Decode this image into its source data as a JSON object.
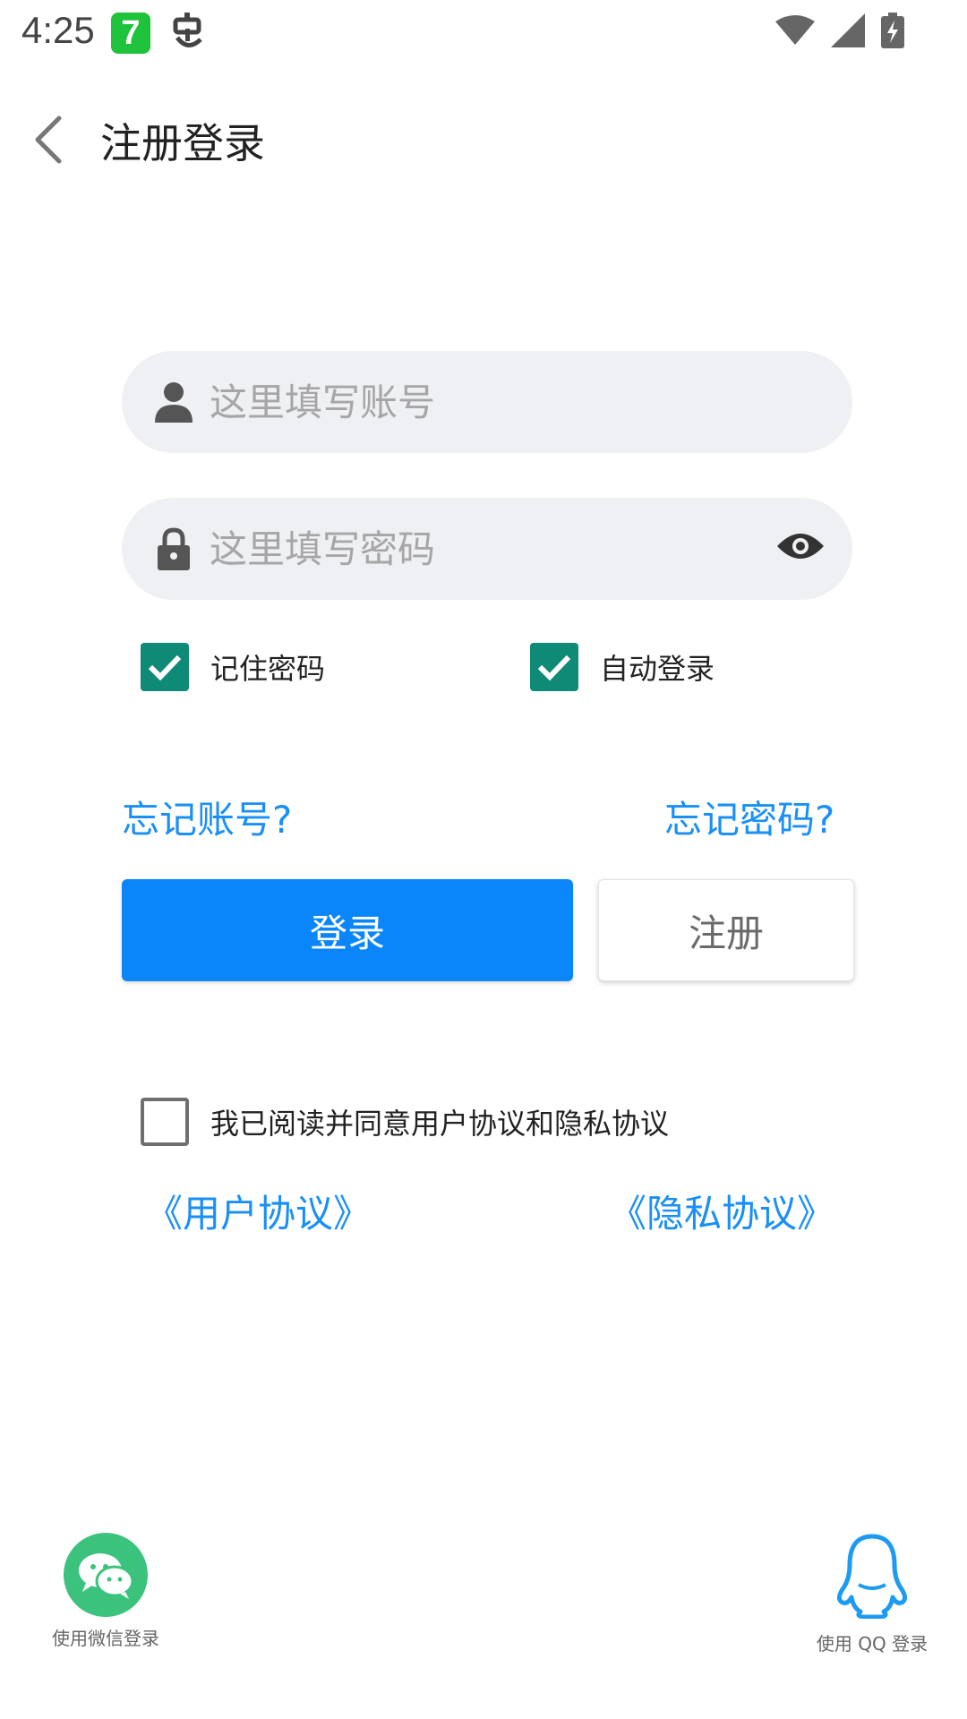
{
  "status_bar": {
    "time": "4:25",
    "app_icon_glyph": "7"
  },
  "header": {
    "title": "注册登录"
  },
  "form": {
    "account_placeholder": "这里填写账号",
    "password_placeholder": "这里填写密码",
    "remember_password_label": "记住密码",
    "auto_login_label": "自动登录",
    "remember_password_checked": true,
    "auto_login_checked": true
  },
  "links": {
    "forgot_account": "忘记账号?",
    "forgot_password": "忘记密码?",
    "user_agreement": "《用户协议》",
    "privacy_agreement": "《隐私协议》"
  },
  "buttons": {
    "login": "登录",
    "register": "注册"
  },
  "agreement": {
    "label": "我已阅读并同意用户协议和隐私协议",
    "checked": false
  },
  "social": {
    "wechat_label": "使用微信登录",
    "qq_label": "使用 QQ 登录"
  },
  "colors": {
    "primary_blue": "#0a86fa",
    "link_blue": "#1a8ff5",
    "checkbox_teal": "#0f8a77",
    "wechat_green": "#3bc27c",
    "qq_blue": "#1d9bf0"
  },
  "icons": {
    "back": "chevron-left-icon",
    "account": "user-icon",
    "password": "lock-icon",
    "visibility": "eye-icon",
    "wechat": "wechat-icon",
    "qq": "qq-penguin-icon"
  }
}
